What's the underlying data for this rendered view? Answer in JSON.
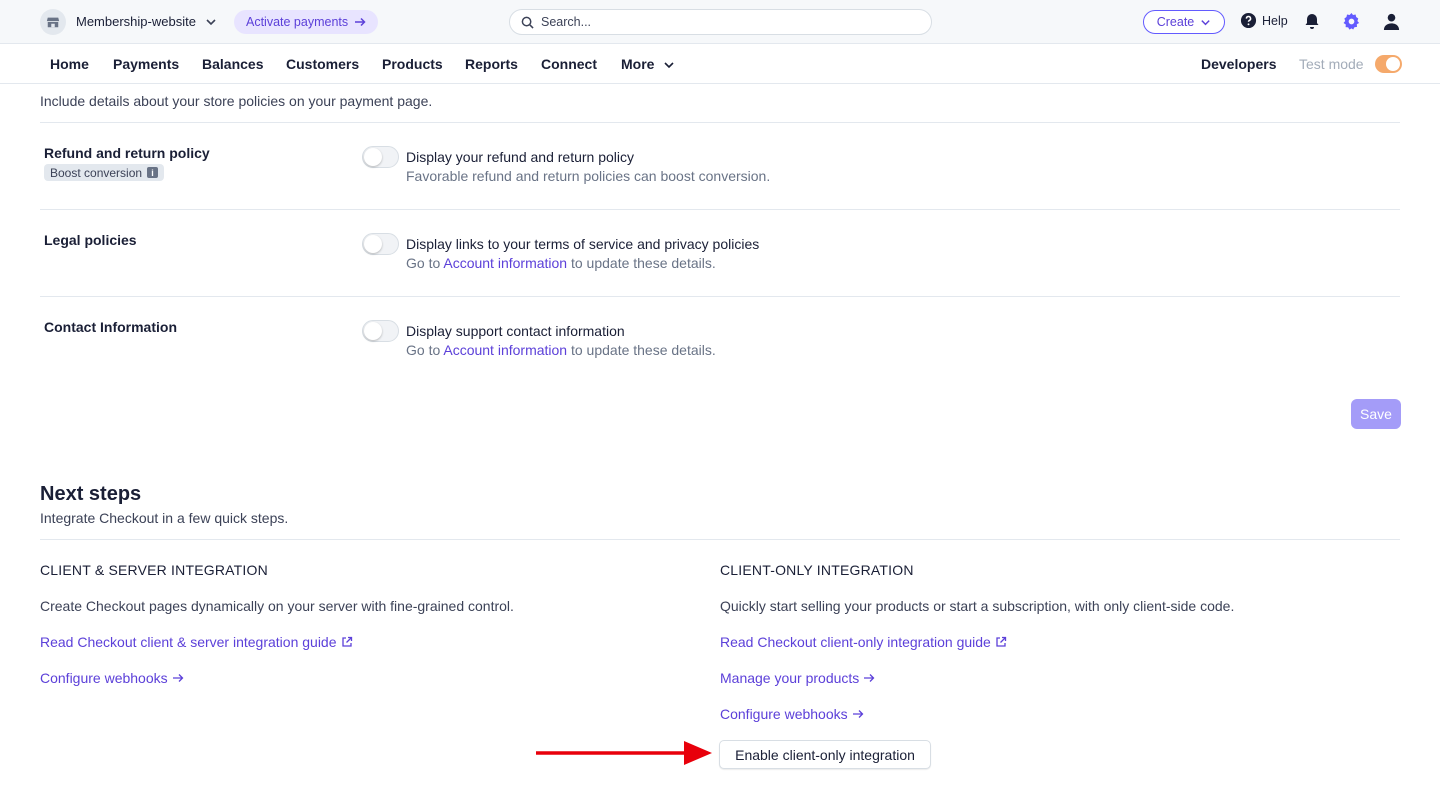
{
  "topbar": {
    "account_name": "Membership-website",
    "activate_label": "Activate payments",
    "search_placeholder": "Search...",
    "create_label": "Create",
    "help_label": "Help"
  },
  "nav": {
    "items": [
      "Home",
      "Payments",
      "Balances",
      "Customers",
      "Products",
      "Reports",
      "Connect",
      "More"
    ],
    "developers": "Developers",
    "test_mode": "Test mode",
    "test_mode_on": true
  },
  "policies": {
    "intro": "Include details about your store policies on your payment page.",
    "rows": [
      {
        "label": "Refund and return policy",
        "badge": "Boost conversion",
        "title": "Display your refund and return policy",
        "desc": "Favorable refund and return policies can boost conversion."
      },
      {
        "label": "Legal policies",
        "title": "Display links to your terms of service and privacy policies",
        "desc_prefix": "Go to ",
        "desc_link": "Account information",
        "desc_suffix": " to update these details."
      },
      {
        "label": "Contact Information",
        "title": "Display support contact information",
        "desc_prefix": "Go to ",
        "desc_link": "Account information",
        "desc_suffix": " to update these details."
      }
    ],
    "save_label": "Save"
  },
  "next_steps": {
    "title": "Next steps",
    "subtitle": "Integrate Checkout in a few quick steps.",
    "left": {
      "heading": "CLIENT & SERVER INTEGRATION",
      "text": "Create Checkout pages dynamically on your server with fine-grained control.",
      "guide_link": "Read Checkout client & server integration guide",
      "webhooks_link": "Configure webhooks"
    },
    "right": {
      "heading": "CLIENT-ONLY INTEGRATION",
      "text": "Quickly start selling your products or start a subscription, with only client-side code.",
      "guide_link": "Read Checkout client-only integration guide",
      "products_link": "Manage your products",
      "webhooks_link": "Configure webhooks",
      "enable_button": "Enable client-only integration"
    }
  },
  "colors": {
    "accent": "#635bff",
    "link": "#5c40d9",
    "annotation_arrow": "#e8000b"
  }
}
